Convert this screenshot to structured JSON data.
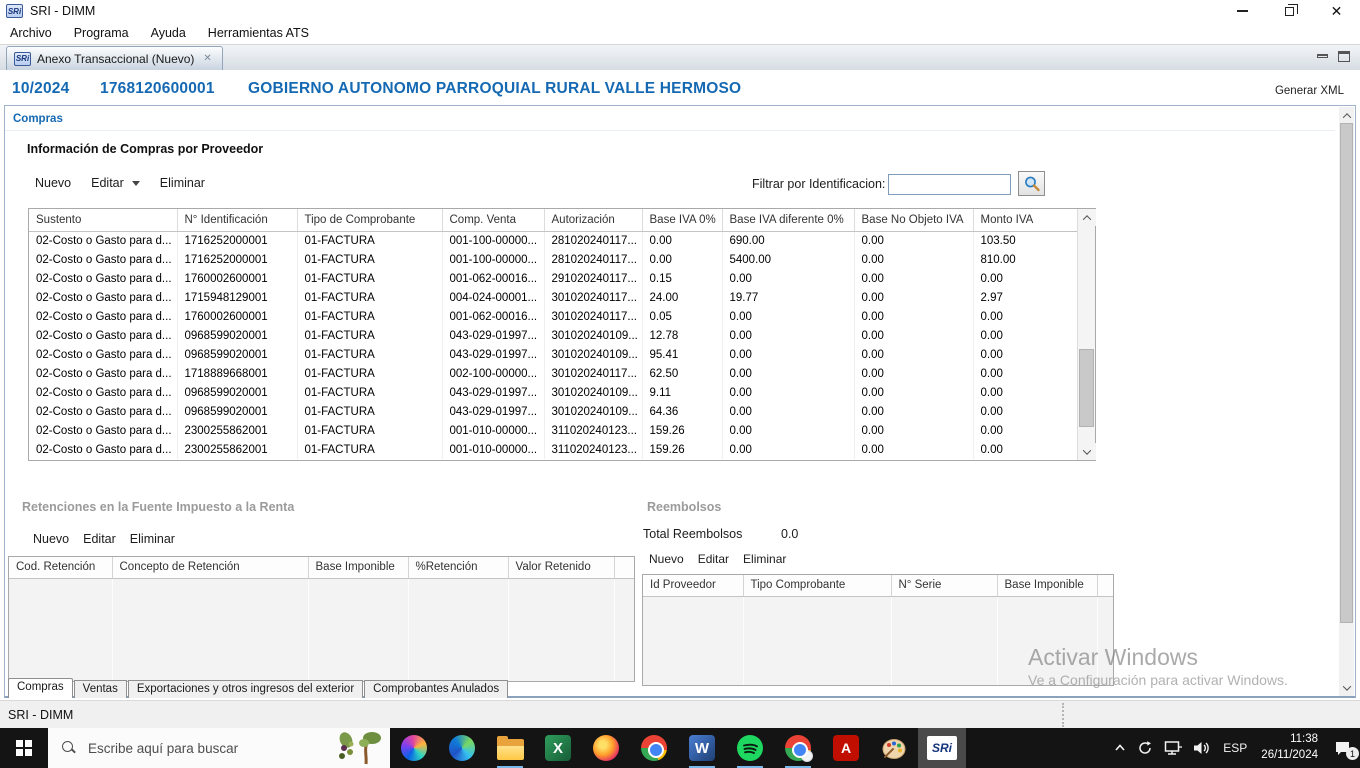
{
  "colors": {
    "accent_blue": "#1569b3",
    "running_underline": "#79b8e8",
    "taskbar_bg": "#141414",
    "gray_title": "#9b9b9b"
  },
  "window": {
    "title": "SRI - DIMM",
    "logo_text": "SRi"
  },
  "menu_bar": [
    "Archivo",
    "Programa",
    "Ayuda",
    "Herramientas ATS"
  ],
  "doc_tab": {
    "label": "Anexo Transaccional (Nuevo)",
    "close_glyph": "✕"
  },
  "header": {
    "period": "10/2024",
    "ruc": "1768120600001",
    "taxpayer_name": "GOBIERNO AUTONOMO PARROQUIAL RURAL VALLE HERMOSO",
    "generate_xml_label": "Generar XML"
  },
  "compras": {
    "section_label": "Compras",
    "title": "Información de Compras por Proveedor",
    "toolbar": {
      "nuevo": "Nuevo",
      "editar": "Editar",
      "eliminar": "Eliminar"
    },
    "filter_label": "Filtrar por Identificacion:",
    "filter_value": "",
    "table": {
      "columns": [
        "Sustento",
        "N° Identificación",
        "Tipo de Comprobante",
        "Comp. Venta",
        "Autorización",
        "Base IVA 0%",
        "Base IVA diferente 0%",
        "Base No Objeto IVA",
        "Monto IVA"
      ],
      "rows": [
        [
          "02-Costo o Gasto para d...",
          "1716252000001",
          "01-FACTURA",
          "001-100-00000...",
          "281020240117...",
          "0.00",
          "690.00",
          "0.00",
          "103.50"
        ],
        [
          "02-Costo o Gasto para d...",
          "1716252000001",
          "01-FACTURA",
          "001-100-00000...",
          "281020240117...",
          "0.00",
          "5400.00",
          "0.00",
          "810.00"
        ],
        [
          "02-Costo o Gasto para d...",
          "1760002600001",
          "01-FACTURA",
          "001-062-00016...",
          "291020240117...",
          "0.15",
          "0.00",
          "0.00",
          "0.00"
        ],
        [
          "02-Costo o Gasto para d...",
          "1715948129001",
          "01-FACTURA",
          "004-024-00001...",
          "301020240117...",
          "24.00",
          "19.77",
          "0.00",
          "2.97"
        ],
        [
          "02-Costo o Gasto para d...",
          "1760002600001",
          "01-FACTURA",
          "001-062-00016...",
          "301020240117...",
          "0.05",
          "0.00",
          "0.00",
          "0.00"
        ],
        [
          "02-Costo o Gasto para d...",
          "0968599020001",
          "01-FACTURA",
          "043-029-01997...",
          "301020240109...",
          "12.78",
          "0.00",
          "0.00",
          "0.00"
        ],
        [
          "02-Costo o Gasto para d...",
          "0968599020001",
          "01-FACTURA",
          "043-029-01997...",
          "301020240109...",
          "95.41",
          "0.00",
          "0.00",
          "0.00"
        ],
        [
          "02-Costo o Gasto para d...",
          "1718889668001",
          "01-FACTURA",
          "002-100-00000...",
          "301020240117...",
          "62.50",
          "0.00",
          "0.00",
          "0.00"
        ],
        [
          "02-Costo o Gasto para d...",
          "0968599020001",
          "01-FACTURA",
          "043-029-01997...",
          "301020240109...",
          "9.11",
          "0.00",
          "0.00",
          "0.00"
        ],
        [
          "02-Costo o Gasto para d...",
          "0968599020001",
          "01-FACTURA",
          "043-029-01997...",
          "301020240109...",
          "64.36",
          "0.00",
          "0.00",
          "0.00"
        ],
        [
          "02-Costo o Gasto para d...",
          "2300255862001",
          "01-FACTURA",
          "001-010-00000...",
          "311020240123...",
          "159.26",
          "0.00",
          "0.00",
          "0.00"
        ],
        [
          "02-Costo o Gasto para d...",
          "2300255862001",
          "01-FACTURA",
          "001-010-00000...",
          "311020240123...",
          "159.26",
          "0.00",
          "0.00",
          "0.00"
        ]
      ]
    }
  },
  "retenciones": {
    "title": "Retenciones en la Fuente  Impuesto a la Renta",
    "toolbar": {
      "nuevo": "Nuevo",
      "editar": "Editar",
      "eliminar": "Eliminar"
    },
    "columns": [
      "Cod. Retención",
      "Concepto de Retención",
      "Base Imponible",
      "%Retención",
      "Valor Retenido"
    ],
    "rows": []
  },
  "reembolsos": {
    "title": "Reembolsos",
    "total_label": "Total Reembolsos",
    "total_value": "0.0",
    "toolbar": {
      "nuevo": "Nuevo",
      "editar": "Editar",
      "eliminar": "Eliminar"
    },
    "columns": [
      "Id Proveedor",
      "Tipo Comprobante",
      "N° Serie",
      "Base Imponible"
    ],
    "rows": []
  },
  "bottom_tabs": [
    "Compras",
    "Ventas",
    "Exportaciones y otros ingresos del exterior",
    "Comprobantes Anulados"
  ],
  "status_bar": {
    "text": "SRI - DIMM"
  },
  "watermark": {
    "line1": "Activar Windows",
    "line2": "Ve a Configuración para activar Windows."
  },
  "taskbar": {
    "search_placeholder": "Escribe aquí para buscar",
    "language": "ESP",
    "time": "11:38",
    "date": "26/11/2024",
    "notification_count": "1",
    "app_icons": [
      "copilot-icon",
      "edge-icon",
      "file-explorer-icon",
      "excel-icon",
      "firefox-icon",
      "chrome-icon",
      "word-icon",
      "spotify-icon",
      "chrome-profile-icon",
      "acrobat-icon",
      "paint-icon",
      "sri-dimm-icon"
    ],
    "tray_icons": [
      "tray-expand-icon",
      "sync-icon",
      "network-icon",
      "volume-icon",
      "notification-icon"
    ],
    "app_letters": {
      "excel": "X",
      "word": "W",
      "acrobat": "A",
      "sri": "SRi"
    }
  }
}
